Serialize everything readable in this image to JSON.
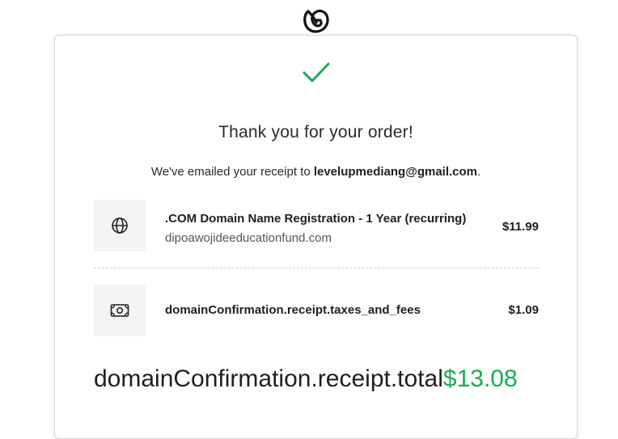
{
  "brand": {
    "logo_icon": "godaddy-logo-icon"
  },
  "confirmation": {
    "status_icon": "check-icon",
    "title": "Thank you for your order!",
    "receipt_prefix": "We've emailed your receipt to ",
    "email": "levelupmediang@gmail.com",
    "receipt_suffix": "."
  },
  "items": [
    {
      "icon": "globe-icon",
      "name": ".COM Domain Name Registration - 1 Year (recurring)",
      "domain": "dipoawojideeducationfund.com",
      "price": "$11.99"
    },
    {
      "icon": "cash-icon",
      "name": "domainConfirmation.receipt.taxes_and_fees",
      "price": "$1.09"
    }
  ],
  "total": {
    "label": "domainConfirmation.receipt.total",
    "value": "$13.08"
  },
  "colors": {
    "accent_green": "#1bab54",
    "icon_box_bg": "#f3f4f6",
    "border": "#d6d6d6"
  }
}
